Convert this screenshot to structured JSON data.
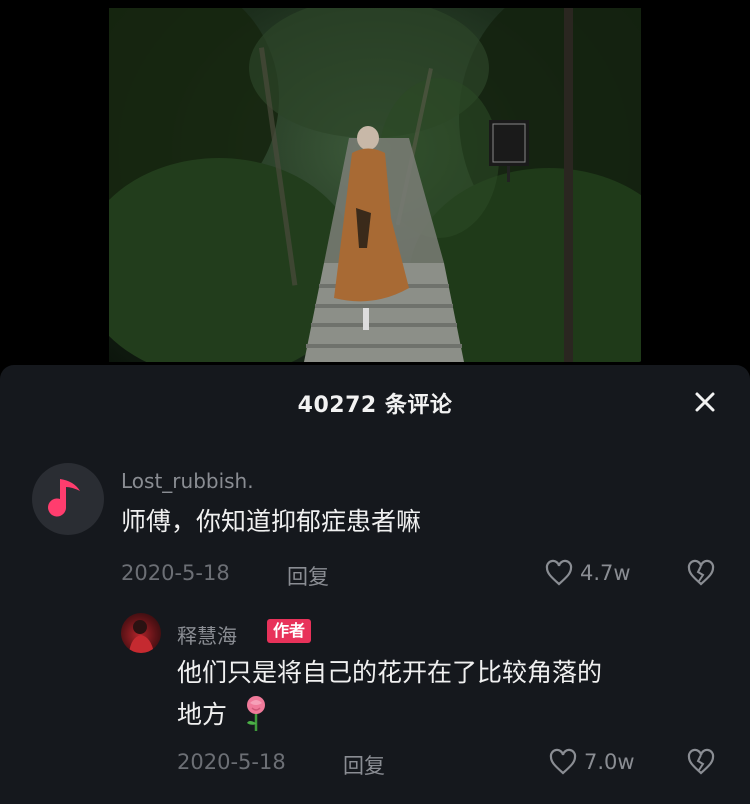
{
  "sheet": {
    "title": "40272 条评论"
  },
  "comments": [
    {
      "username": "Lost_rubbish.",
      "text": "师傅，你知道抑郁症患者嘛",
      "date": "2020-5-18",
      "reply_label": "回复",
      "likes": "4.7w",
      "avatar_icon": "music-note-icon"
    },
    {
      "username": "释慧海",
      "author_badge": "作者",
      "text_line1": "他们只是将自己的花开在了比较角落的",
      "text_line2": "地方",
      "date": "2020-5-18",
      "reply_label": "回复",
      "likes": "7.0w",
      "emoji": "rose-icon"
    }
  ],
  "colors": {
    "sheet_bg": "#15181d",
    "accent_pink": "#e8325a",
    "text_primary": "#f0f0f0",
    "text_secondary": "#8a8d93"
  }
}
